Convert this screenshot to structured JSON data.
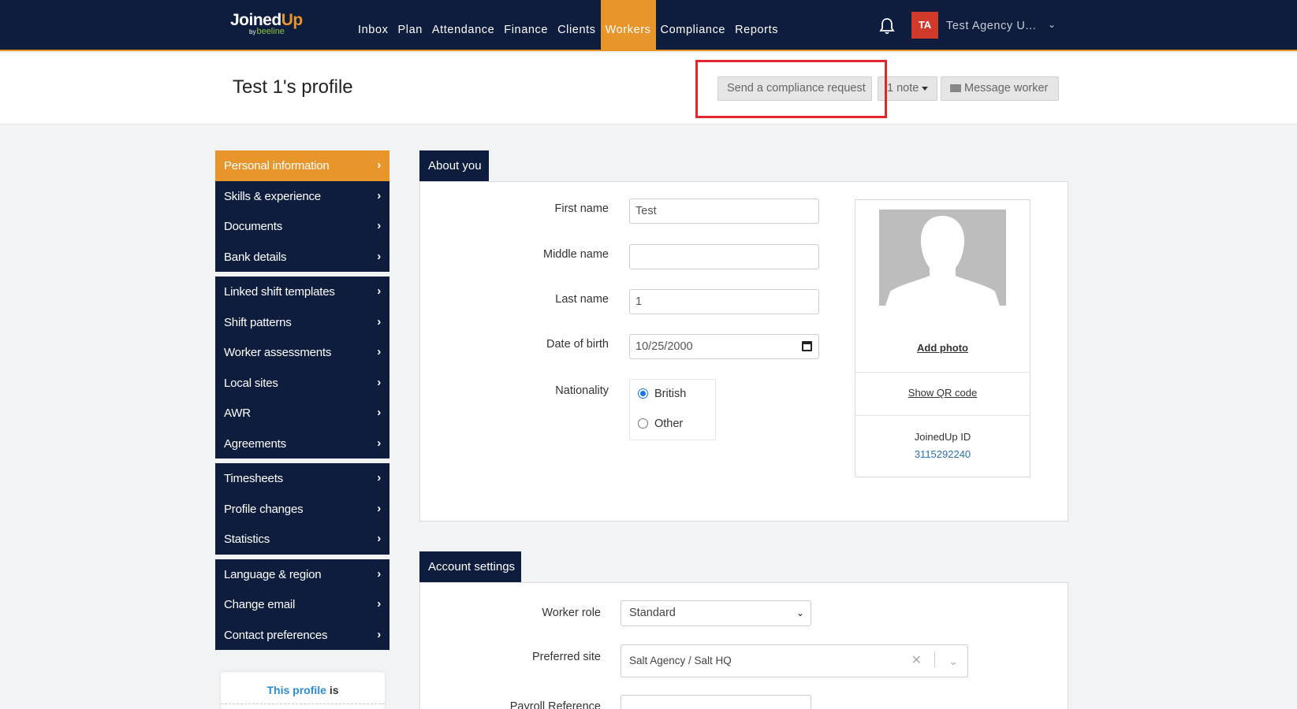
{
  "brand": {
    "name_main": "Joined",
    "name_accent": "Up",
    "by": "by",
    "partner": "beeline"
  },
  "nav": {
    "items": [
      "Inbox",
      "Plan",
      "Attendance",
      "Finance",
      "Clients",
      "Workers",
      "Compliance",
      "Reports"
    ],
    "active": "Workers"
  },
  "user": {
    "initials": "TA",
    "agency": "Test Agency U..."
  },
  "header": {
    "title": "Test 1's profile",
    "compliance_button": "Send a compliance request",
    "note_button": "1 note",
    "message_button": "Message worker"
  },
  "sidebar": {
    "groups": [
      [
        "Personal information",
        "Skills & experience",
        "Documents",
        "Bank details"
      ],
      [
        "Linked shift templates",
        "Shift patterns",
        "Worker assessments",
        "Local sites",
        "AWR",
        "Agreements"
      ],
      [
        "Timesheets",
        "Profile changes",
        "Statistics"
      ],
      [
        "Language & region",
        "Change email",
        "Contact preferences"
      ]
    ],
    "active": "Personal information",
    "profile_card": {
      "link": "This profile",
      "suffix": "is"
    }
  },
  "about": {
    "tab": "About you",
    "first_name_label": "First name",
    "first_name": "Test",
    "middle_name_label": "Middle name",
    "middle_name": "",
    "last_name_label": "Last name",
    "last_name": "1",
    "dob_label": "Date of birth",
    "dob": "10/25/2000",
    "nationality_label": "Nationality",
    "nationality_options": [
      "British",
      "Other"
    ],
    "nationality_selected": "British",
    "add_photo": "Add photo",
    "show_qr": "Show QR code",
    "joinedup_id_label": "JoinedUp ID",
    "joinedup_id": "3115292240"
  },
  "account": {
    "tab": "Account settings",
    "worker_role_label": "Worker role",
    "worker_role": "Standard",
    "preferred_site_label": "Preferred site",
    "preferred_site": "Salt Agency / Salt HQ",
    "payroll_label": "Payroll Reference"
  },
  "colors": {
    "navy": "#0e1c3d",
    "accent": "#e8962b",
    "avatar": "#d13a2a",
    "highlight": "#e3262d"
  }
}
